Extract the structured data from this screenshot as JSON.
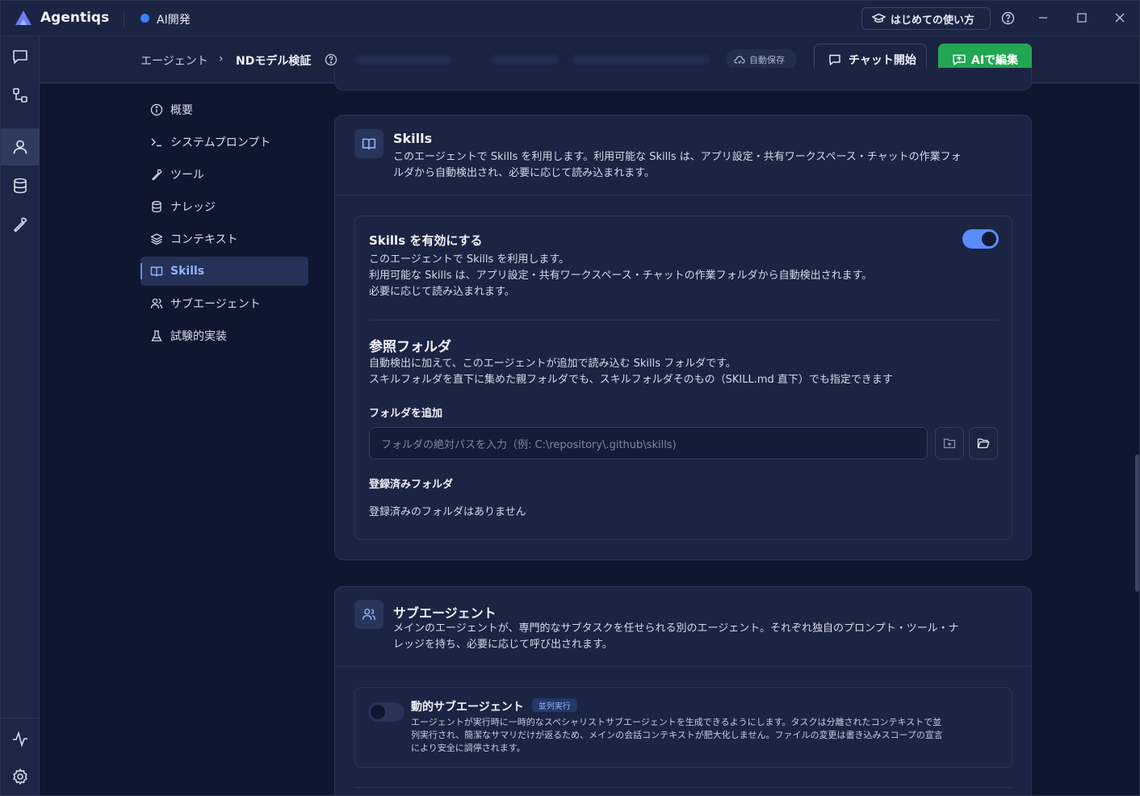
{
  "app": {
    "name": "Agentiqs",
    "workspace": "AI開発",
    "guide_label": "はじめての使い方"
  },
  "header": {
    "breadcrumb_root": "エージェント",
    "breadcrumb_sep": "›",
    "breadcrumb_current": "NDモデル検証",
    "autosave": "自動保存",
    "chat_button": "チャット開始",
    "ai_edit_button": "AIで編集"
  },
  "nav": {
    "items": [
      {
        "label": "概要",
        "icon": "info-icon"
      },
      {
        "label": "システムプロンプト",
        "icon": "terminal-icon"
      },
      {
        "label": "ツール",
        "icon": "wrench-icon"
      },
      {
        "label": "ナレッジ",
        "icon": "database-icon"
      },
      {
        "label": "コンテキスト",
        "icon": "layers-icon"
      },
      {
        "label": "Skills",
        "icon": "book-icon",
        "active": true
      },
      {
        "label": "サブエージェント",
        "icon": "users-icon"
      },
      {
        "label": "試験的実装",
        "icon": "flask-icon"
      }
    ]
  },
  "skills": {
    "title": "Skills",
    "desc_line1": "このエージェントで Skills を利用します。利用可能な Skills は、アプリ設定・共有ワークスペース・チャットの作業フォ",
    "desc_line2": "ルダから自動検出され、必要に応じて読み込まれます。",
    "enable": {
      "title": "Skills を有効にする",
      "line1": "このエージェントで Skills を利用します。",
      "line2": "利用可能な Skills は、アプリ設定・共有ワークスペース・チャットの作業フォルダから自動検出されます。",
      "line3": "必要に応じて読み込まれます。",
      "enabled": true
    },
    "ref": {
      "title": "参照フォルダ",
      "line1": "自動検出に加えて、このエージェントが追加で読み込む Skills フォルダです。",
      "line2": "スキルフォルダを直下に集めた親フォルダでも、スキルフォルダそのもの（SKILL.md 直下）でも指定できます",
      "add_label": "フォルダを追加",
      "input_placeholder": "フォルダの絶対パスを入力（例: C:\\repository\\.github\\skills)",
      "registered_label": "登録済みフォルダ",
      "empty_text": "登録済みのフォルダはありません"
    }
  },
  "subagent": {
    "title": "サブエージェント",
    "desc_line1": "メインのエージェントが、専門的なサブタスクを任せられる別のエージェント。それぞれ独自のプロンプト・ツール・ナ",
    "desc_line2": "レッジを持ち、必要に応じて呼び出されます。",
    "dynamic": {
      "title": "動的サブエージェント",
      "badge": "並列実行",
      "line1": "エージェントが実行時に一時的なスペシャリストサブエージェントを生成できるようにします。タスクは分離されたコンテキストで並",
      "line2": "列実行され、簡潔なサマリだけが返るため、メインの会話コンテキストが肥大化しません。ファイルの変更は書き込みスコープの宣言",
      "line3": "により安全に調停されます。",
      "enabled": false
    }
  },
  "colors": {
    "accent": "#5b8cff",
    "green": "#22a652",
    "bg": "#0f1730",
    "card": "#1b2442"
  }
}
